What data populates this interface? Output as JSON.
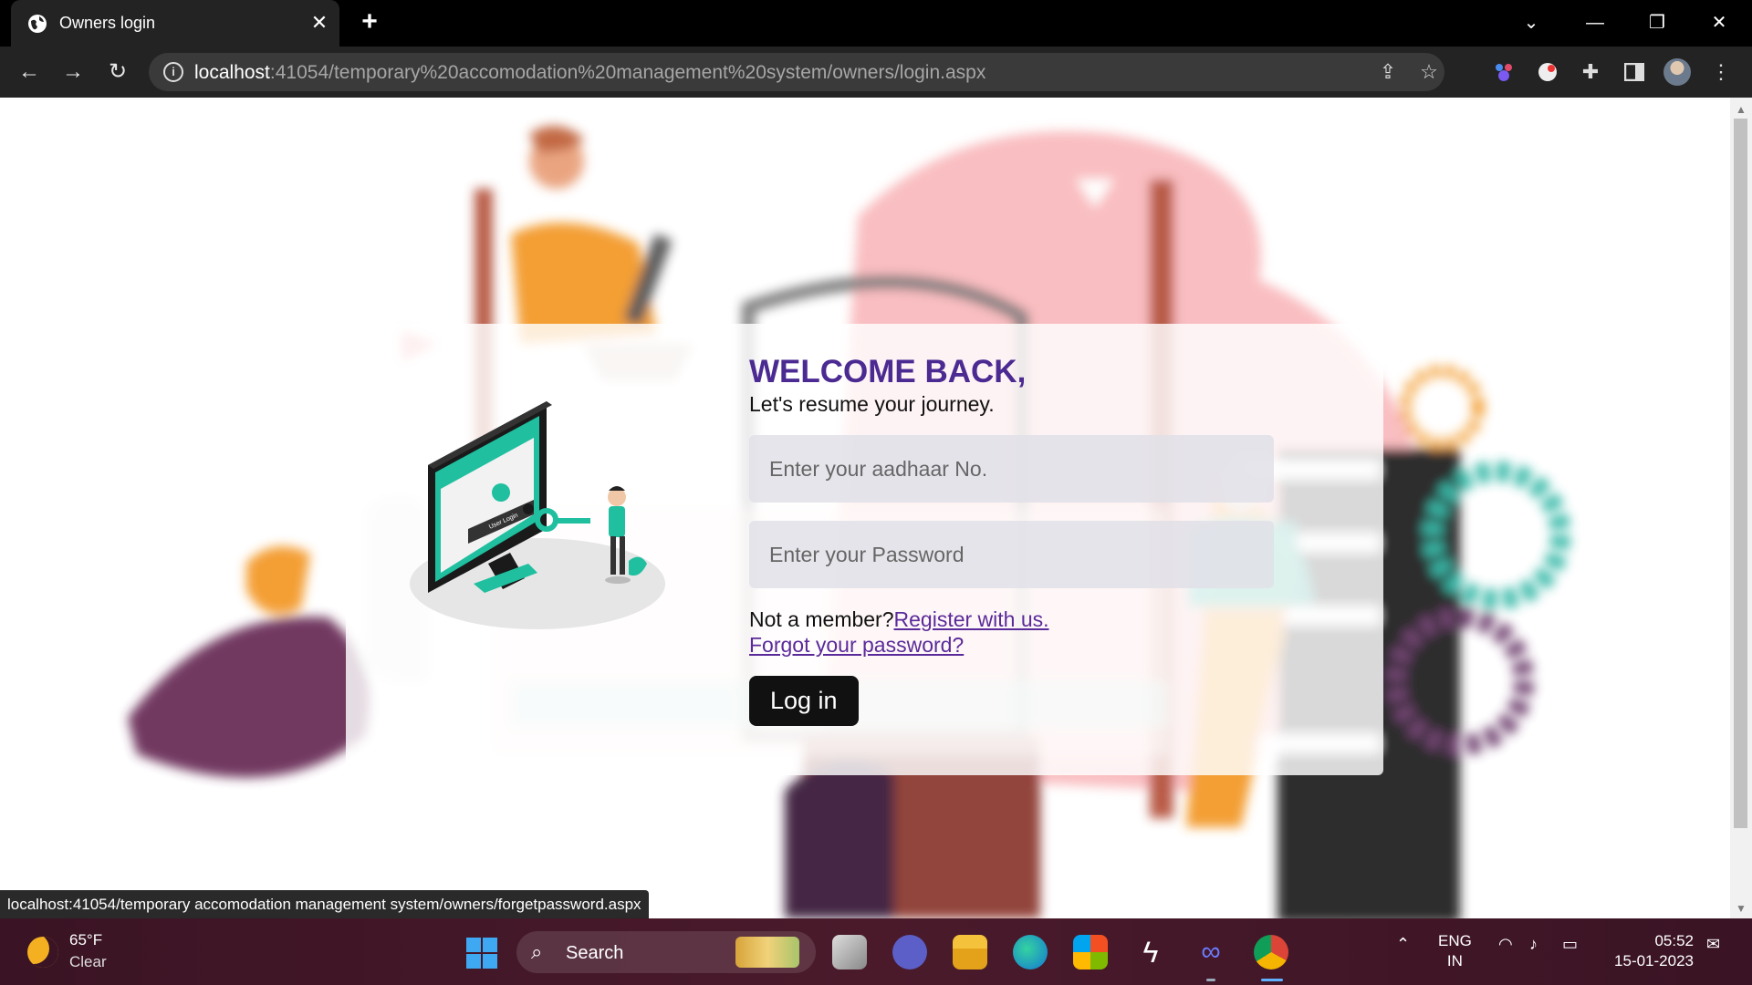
{
  "browser": {
    "tab_title": "Owners login",
    "tab_close": "✕",
    "new_tab": "+",
    "url_host": "localhost",
    "url_rest": ":41054/temporary%20accomodation%20management%20system/owners/login.aspx",
    "window_minimize": "—",
    "window_restore": "❐",
    "window_close": "✕",
    "tab_search": "⌄"
  },
  "page": {
    "welcome": "WELCOME BACK,",
    "subtitle": "Let's resume your journey.",
    "aadhaar_placeholder": "Enter your aadhaar No.",
    "password_placeholder": "Enter your Password",
    "not_member": "Not a member?",
    "register_link": "Register with us.",
    "forgot_link": "Forgot your password?",
    "login_button": "Log in",
    "illustration_label": "User Login"
  },
  "status_url": "localhost:41054/temporary accomodation management system/owners/forgetpassword.aspx",
  "taskbar": {
    "weather_temp": "65°F",
    "weather_desc": "Clear",
    "search_label": "Search",
    "lang_top": "ENG",
    "lang_bottom": "IN",
    "time": "05:52",
    "date": "15-01-2023"
  },
  "colors": {
    "accent_heading": "#4b2a92",
    "link": "#5a2a9a",
    "button_bg": "#111111",
    "teal_illustration": "#1fbf9f"
  }
}
